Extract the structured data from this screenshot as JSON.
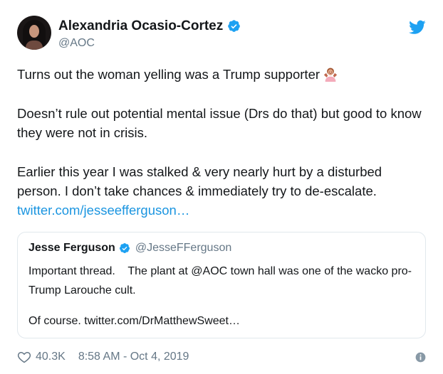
{
  "author": {
    "display_name": "Alexandria Ocasio-Cortez",
    "handle": "@AOC",
    "avatar_icon": "profile-photo",
    "verified_icon": "verified-badge-icon"
  },
  "brand": {
    "icon": "twitter-bird-icon",
    "accent": "#1da1f2",
    "link_color": "#1b95e0",
    "muted_color": "#657786"
  },
  "tweet": {
    "para1": "Turns out the woman yelling was a Trump supporter",
    "emoji": "woman-shrugging-emoji",
    "para2": "Doesn’t rule out potential mental issue (Drs do that) but good to know they were not in crisis.",
    "para3": "Earlier this year I was stalked & very nearly hurt by a disturbed person. I don’t take chances & immediately try to de-escalate.",
    "link_text": "twitter.com/jesseefferguson…"
  },
  "quoted": {
    "display_name": "Jesse Ferguson",
    "handle": "@JesseFFerguson",
    "para1": "Important thread.    The plant at @AOC town hall was one of the wacko pro-Trump Larouche cult.",
    "para2": "Of course. twitter.com/DrMatthewSweet…"
  },
  "footer": {
    "like_count": "40.3K",
    "timestamp": "8:58 AM - Oct 4, 2019",
    "like_icon": "heart-icon",
    "info_icon": "info-icon"
  }
}
